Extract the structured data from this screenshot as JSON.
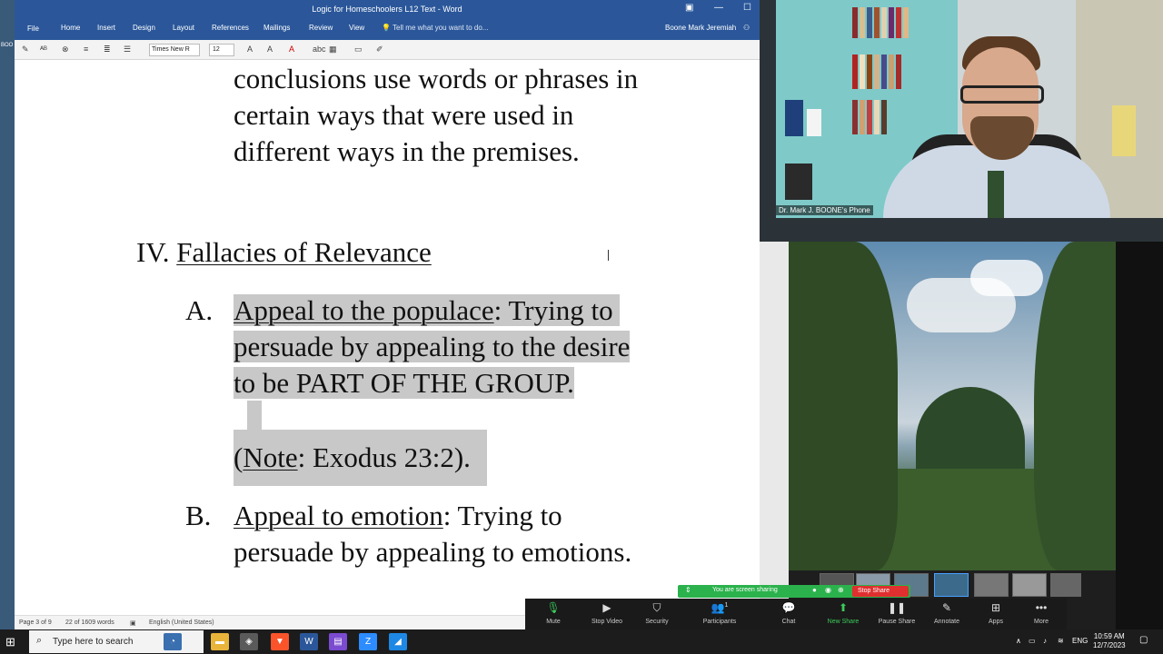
{
  "word": {
    "title": "Logic for Homeschoolers L12 Text - Word",
    "menu": [
      "File",
      "Home",
      "Insert",
      "Design",
      "Layout",
      "References",
      "Mailings",
      "Review",
      "View"
    ],
    "tell_me": "Tell me what you want to do...",
    "user": "Boone Mark Jeremiah",
    "font_name": "Times New R",
    "font_size": "12",
    "status": {
      "page": "Page 3 of 9",
      "words": "22 of 1609 words",
      "language": "English (United States)"
    }
  },
  "doc": {
    "intro_lines": [
      "conclusions use words or phrases in",
      "certain ways that were used in",
      "different ways in the premises."
    ],
    "section_num": "IV.",
    "section_title": "Fallacies of Relevance",
    "a_label": "A.",
    "a_term": "Appeal to the populace",
    "a_line1_rest": ": Trying to",
    "a_line2": "persuade by appealing to the desire",
    "a_line3": "to be PART OF THE GROUP.",
    "note_open": "(",
    "note_term": "Note",
    "note_rest": ": Exodus 23:2).",
    "b_label": "B.",
    "b_term": "Appeal to emotion",
    "b_line1_rest": ": Trying to",
    "b_line2": "persuade by appealing to emotions."
  },
  "zoom": {
    "video_label": "Dr. Mark J. BOONE's Phone",
    "sharing_text": "You are screen sharing",
    "stop_share": "Stop Share",
    "toolbar": [
      {
        "label": "Mute",
        "icon": "microphone-icon"
      },
      {
        "label": "Stop Video",
        "icon": "video-camera-icon"
      },
      {
        "label": "Security",
        "icon": "shield-icon"
      },
      {
        "label": "Participants",
        "icon": "participants-icon"
      },
      {
        "label": "Chat",
        "icon": "chat-icon"
      },
      {
        "label": "New Share",
        "icon": "share-icon"
      },
      {
        "label": "Pause Share",
        "icon": "pause-icon"
      },
      {
        "label": "Annotate",
        "icon": "pen-icon"
      },
      {
        "label": "Apps",
        "icon": "apps-icon"
      },
      {
        "label": "More",
        "icon": "more-icon"
      }
    ],
    "participants_count": "1",
    "share_color": "#2bb24c",
    "stop_color": "#e02f2f"
  },
  "taskbar": {
    "search_placeholder": "Type here to search",
    "time": "10:59 AM",
    "date": "12/7/2023",
    "lang": "ENG"
  },
  "desktop_strip": {
    "label": "BOO"
  }
}
